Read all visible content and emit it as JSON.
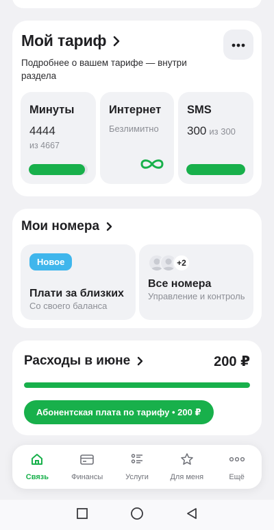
{
  "tariff": {
    "title": "Мой тариф",
    "subtitle": "Подробнее о вашем тарифе — внутри раздела",
    "tiles": {
      "minutes": {
        "label": "Минуты",
        "value": "4444",
        "total": "из 4667",
        "remaining_fraction": 0.952
      },
      "internet": {
        "label": "Интернет",
        "note": "Безлимитно",
        "icon": "infinity-icon"
      },
      "sms": {
        "label": "SMS",
        "value": "300",
        "total": "из 300",
        "remaining_fraction": 1.0
      }
    }
  },
  "numbers": {
    "title": "Мои номера",
    "pay_for_family": {
      "badge": "Новое",
      "title": "Плати за близких",
      "subtitle": "Со своего баланса"
    },
    "all_numbers": {
      "extra_count": "+2",
      "title": "Все номера",
      "subtitle": "Управление и контроль"
    }
  },
  "expenses": {
    "title": "Расходы в июне",
    "amount": "200 ₽",
    "fill_fraction": 1.0,
    "button_label": "Абонентская плата по тарифу • 200 ₽"
  },
  "nav": {
    "items": [
      {
        "label": "Связь",
        "icon": "home-icon",
        "active": true
      },
      {
        "label": "Финансы",
        "icon": "card-icon",
        "active": false
      },
      {
        "label": "Услуги",
        "icon": "services-icon",
        "active": false
      },
      {
        "label": "Для меня",
        "icon": "star-icon",
        "active": false
      },
      {
        "label": "Ещё",
        "icon": "more-dots-icon",
        "active": false
      }
    ]
  },
  "system_nav": {
    "icons": [
      "recents-icon",
      "home-circle-icon",
      "back-icon"
    ]
  },
  "colors": {
    "accent": "#18b04b",
    "badge": "#3fb6ec",
    "background": "#f1f1f4",
    "tile": "#f1f2f5"
  }
}
